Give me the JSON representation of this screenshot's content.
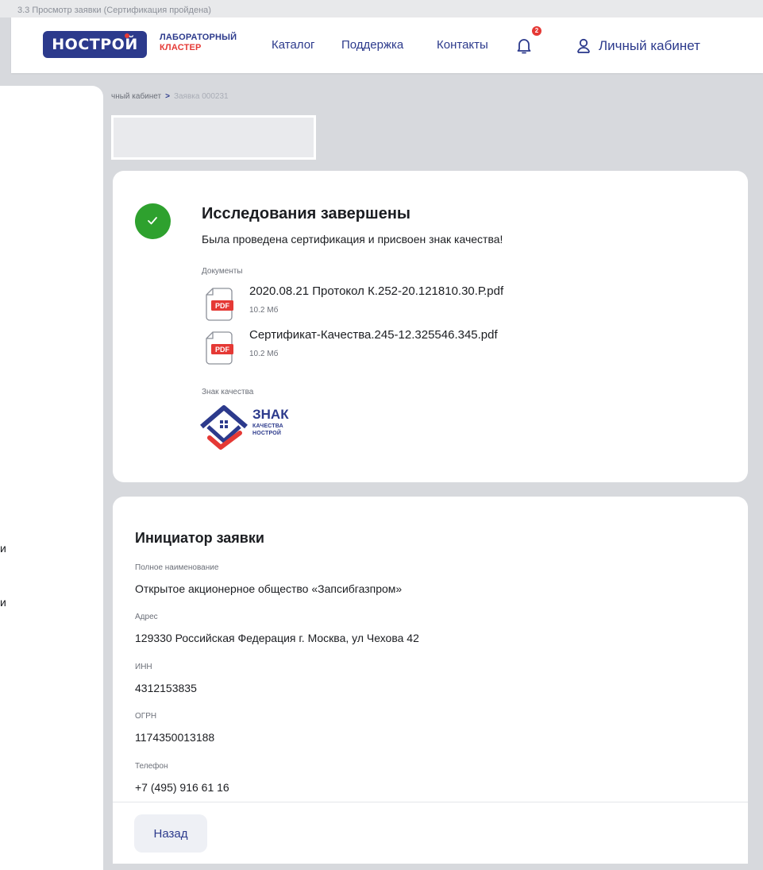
{
  "frame_caption": "3.3 Просмотр заявки (Сертификация пройдена)",
  "header": {
    "logo_text": "НОСТРОЙ",
    "brand_line1": "ЛАБОРАТОРНЫЙ",
    "brand_line2": "КЛАСТЕР",
    "nav": [
      "Каталог",
      "Поддержка",
      "Контакты"
    ],
    "notifications_count": "2",
    "cabinet_label": "Личный кабинет"
  },
  "sidebar": {
    "item_1": "и",
    "item_2": "и"
  },
  "breadcrumb": {
    "parent": "чный кабинет",
    "separator": ">",
    "current": "Заявка 000231"
  },
  "status_card": {
    "title": "Исследования завершены",
    "subtitle": "Была проведена сертификация и присвоен знак качества!",
    "documents_label": "Документы",
    "documents": [
      {
        "name": "2020.08.21 Протокол К.252-20.121810.30.Р.pdf",
        "size": "10.2 Мб",
        "badge": "PDF"
      },
      {
        "name": "Сертификат-Качества.245-12.325546.345.pdf",
        "size": "10.2 Мб",
        "badge": "PDF"
      }
    ],
    "quality_label": "Знак качества",
    "quality_mark": {
      "line1": "ЗНАК",
      "line2": "КАЧЕСТВА",
      "line3": "НОСТРОЙ"
    }
  },
  "initiator": {
    "title": "Инициатор заявки",
    "fields": [
      {
        "label": "Полное наименование",
        "value": "Открытое акционерное общество «Запсибгазпром»"
      },
      {
        "label": "Адрес",
        "value": "129330 Российская Федерация г. Москва, ул Чехова 42"
      },
      {
        "label": "ИНН",
        "value": "4312153835"
      },
      {
        "label": "ОГРН",
        "value": "1174350013188"
      },
      {
        "label": "Телефон",
        "value": "+7 (495) 916 61 16"
      }
    ]
  },
  "footer": {
    "back_label": "Назад"
  },
  "colors": {
    "brand": "#2c3a8c",
    "accent": "#e53935",
    "success": "#2ea12e",
    "background": "#d7d9dd"
  }
}
